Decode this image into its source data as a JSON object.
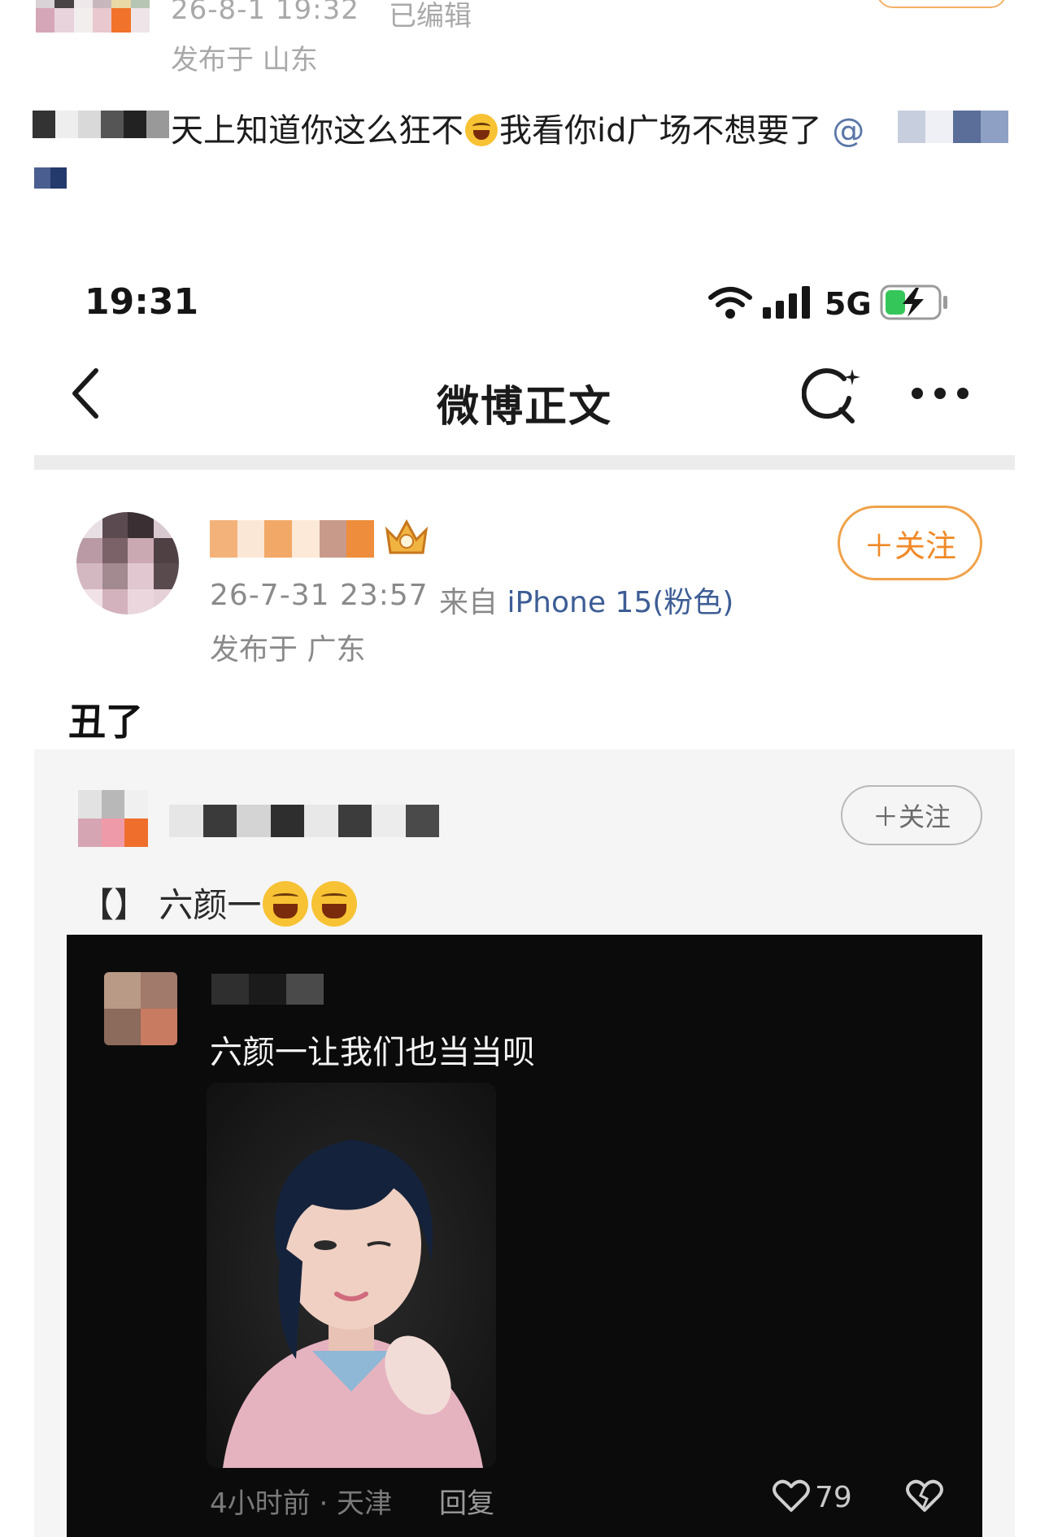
{
  "outer_post": {
    "time": "26-8-1 19:32",
    "edited_label": "已编辑",
    "location": "发布于 山东",
    "text_visible": "天上知道你这么狂不",
    "text_after_emoji": "我看你id广场不想要了",
    "mention_prefix": "@"
  },
  "status_bar": {
    "time": "19:31",
    "network": "5G"
  },
  "nav": {
    "title": "微博正文"
  },
  "post": {
    "time": "26-7-31 23:57",
    "source_prefix": "来自",
    "device": "iPhone 15(粉色)",
    "location": "发布于 广东",
    "follow_label": "＋关注",
    "body": "丑了"
  },
  "quoted": {
    "follow_label": "＋关注",
    "text": "【】 六颜一"
  },
  "comment": {
    "text": "六颜一让我们也当当呗",
    "meta": "4小时前 · 天津",
    "reply": "回复",
    "likes": "79"
  },
  "colors": {
    "accent_orange": "#f08a28",
    "link_blue": "#3d5d95",
    "dark_panel": "#0b0b0b"
  }
}
